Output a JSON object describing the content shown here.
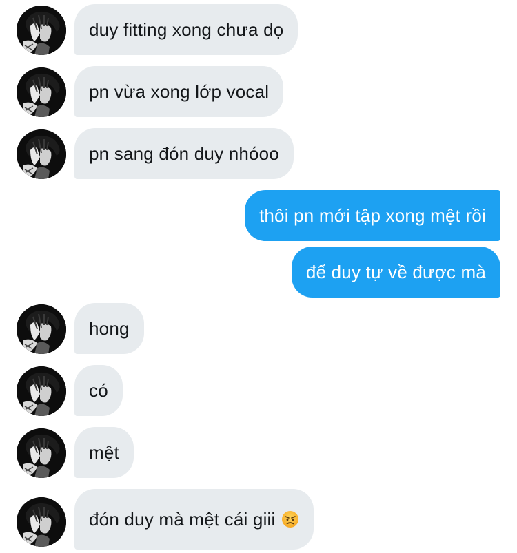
{
  "conversation": {
    "messages": [
      {
        "from": "them",
        "text": "duy fitting xong chưa dọ"
      },
      {
        "from": "them",
        "text": "pn vừa xong lớp vocal"
      },
      {
        "from": "them",
        "text": "pn sang đón duy nhóoo"
      },
      {
        "from": "me",
        "text": "thôi pn mới tập xong mệt rồi"
      },
      {
        "from": "me",
        "text": "để duy tự về được mà"
      },
      {
        "from": "them",
        "text": "hong"
      },
      {
        "from": "them",
        "text": "có"
      },
      {
        "from": "them",
        "text": "mệt"
      },
      {
        "from": "them",
        "text": "đón duy mà mệt cái giii",
        "emoji": "angry-face-emoji"
      }
    ]
  },
  "colors": {
    "incoming_bubble": "#e7ebee",
    "outgoing_bubble": "#1da1f2",
    "incoming_text": "#14171a",
    "outgoing_text": "#ffffff"
  }
}
